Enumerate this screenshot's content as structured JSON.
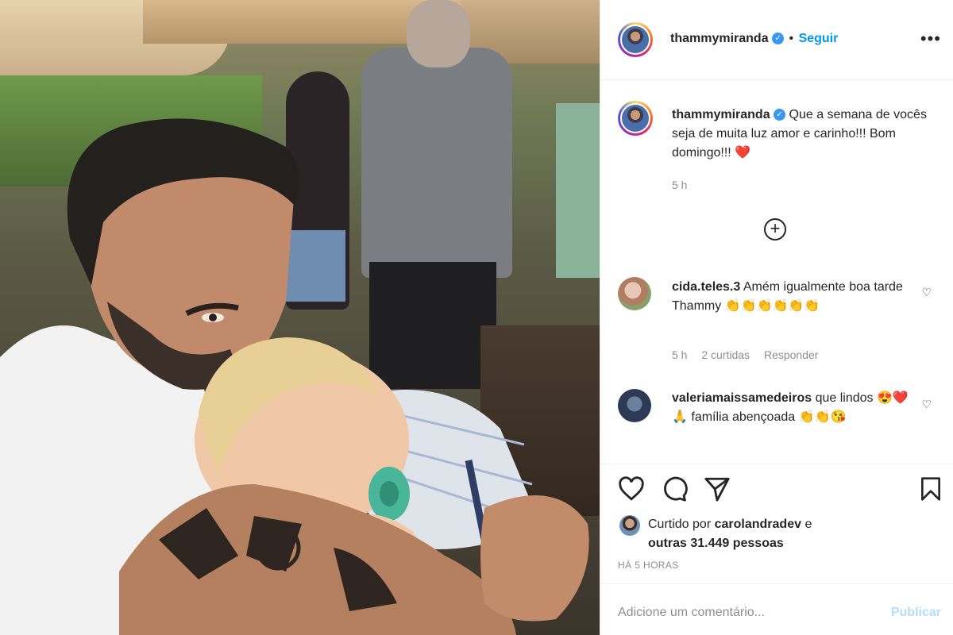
{
  "post": {
    "username": "thammymiranda",
    "follow_label": "Seguir",
    "more_label": "•••",
    "verified_symbol": "✓",
    "separator": "•"
  },
  "caption": {
    "username": "thammymiranda",
    "text": "Que a semana de vocês seja de muita luz amor e carinho!!! Bom domingo!!!",
    "emoji": "❤️",
    "time": "5 h"
  },
  "load_more_label": "+",
  "comments": [
    {
      "username": "cida.teles.3",
      "text": "Amém igualmente boa tarde Thammy",
      "emoji": "👏👏👏👏👏👏",
      "time": "5 h",
      "likes": "2 curtidas",
      "reply": "Responder"
    },
    {
      "username": "valeriamaissamedeiros",
      "text": "que lindos",
      "emoji_a": "😍❤️ 🙏",
      "text_b": "família abençoada",
      "emoji_b": "👏👏😘"
    }
  ],
  "likes": {
    "prefix": "Curtido por",
    "user": "carolandradev",
    "conj": "e",
    "others": "outras 31.449 pessoas"
  },
  "timestamp": "HÁ 5 HORAS",
  "add_comment": {
    "placeholder": "Adicione um comentário...",
    "publish": "Publicar"
  },
  "colors": {
    "accent": "#0095f6",
    "publish_disabled": "#b2dffc",
    "verified": "#3897f0",
    "heart": "#ed4956",
    "muted": "#8e8e8e"
  },
  "icons": [
    "heart-icon",
    "comment-icon",
    "share-icon",
    "bookmark-icon",
    "more-icon",
    "plus-circle-icon",
    "verified-icon"
  ]
}
